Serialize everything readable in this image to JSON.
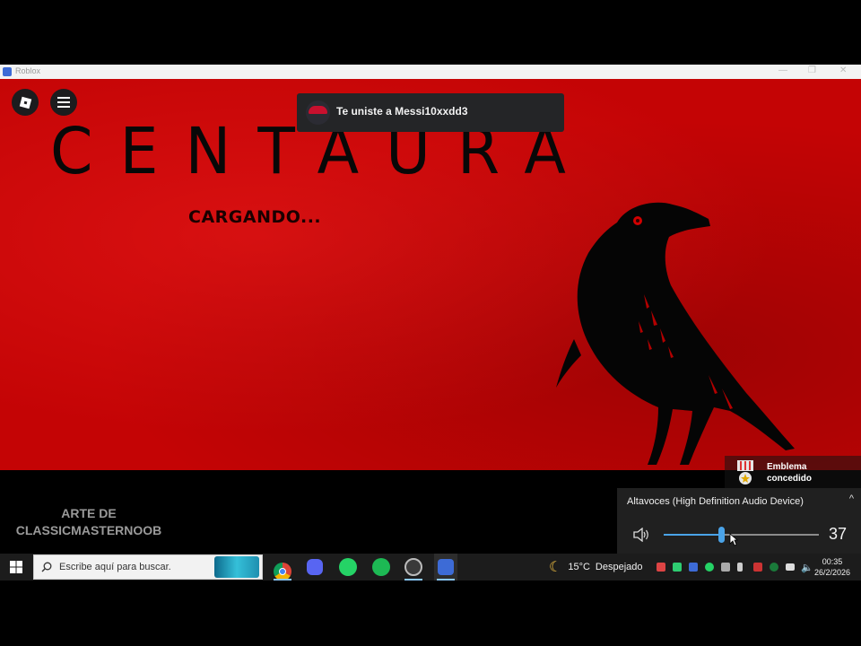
{
  "window": {
    "title": "Roblox",
    "minimize_glyph": "—",
    "restore_glyph": "❐",
    "close_glyph": "✕"
  },
  "game": {
    "title": "CENTAURA",
    "loading_text": "CARGANDO...",
    "background_color": "#c40405"
  },
  "roblox_menu": {
    "icons": [
      "roblox-logo-icon",
      "hamburger-menu-icon"
    ]
  },
  "notification": {
    "message": "Te uniste a Messi10xxdd3",
    "avatar_icon": "avatar-icon"
  },
  "badge_notification": {
    "line1": "Emblema",
    "line2": "concedido",
    "icon": "medal-icon"
  },
  "credit": {
    "line1": "ARTE DE",
    "line2": "CLASSICMASTERNOOB"
  },
  "volume_flyout": {
    "device_name": "Altavoces (High Definition Audio Device)",
    "volume": 37,
    "collapse_glyph": "^",
    "speaker_icon": "speaker-icon",
    "accent_color": "#4aa3e8"
  },
  "taskbar": {
    "search_placeholder": "Escribe aquí para buscar.",
    "apps": [
      {
        "name": "chrome",
        "icon": "chrome-icon",
        "active": true
      },
      {
        "name": "discord",
        "icon": "discord-icon",
        "active": false
      },
      {
        "name": "whatsapp",
        "icon": "whatsapp-icon",
        "active": false
      },
      {
        "name": "spotify",
        "icon": "spotify-icon",
        "active": false
      },
      {
        "name": "obs",
        "icon": "obs-icon",
        "active": true
      },
      {
        "name": "roblox",
        "icon": "roblox-icon",
        "active": true
      }
    ],
    "weather": {
      "temperature": "15°C",
      "condition": "Despejado",
      "icon": "moon-icon"
    },
    "clock": {
      "time": "00:35",
      "date": "26/2/2026"
    }
  }
}
